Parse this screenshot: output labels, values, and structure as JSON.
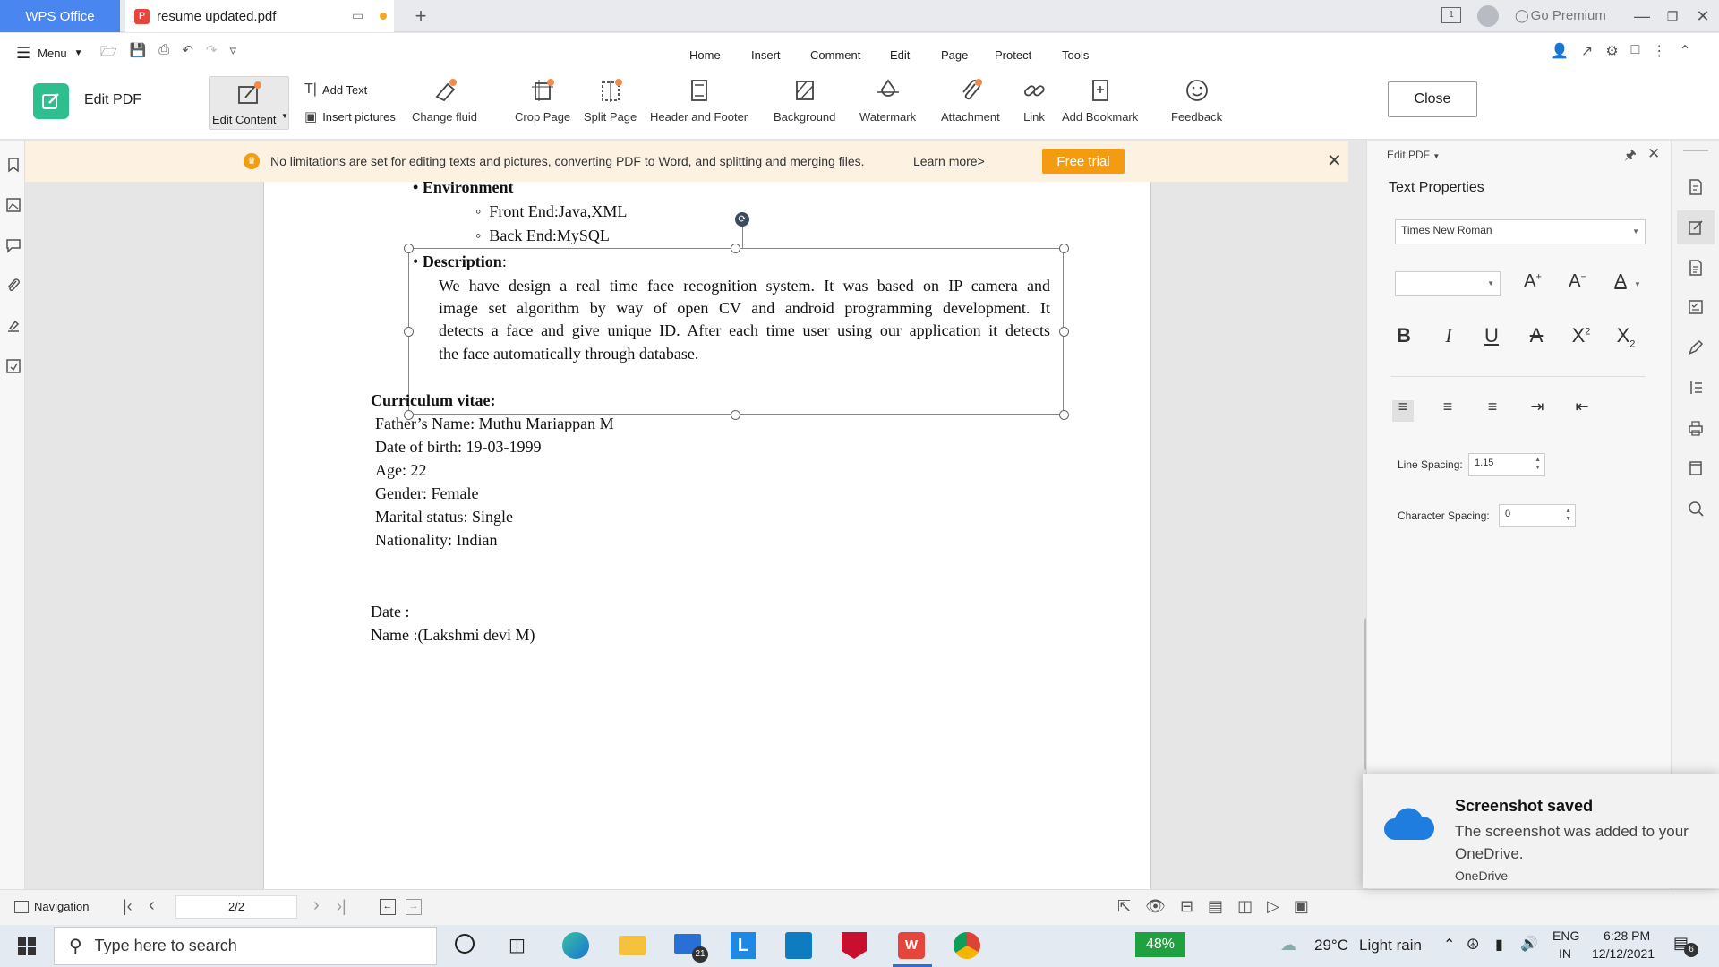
{
  "titlebar": {
    "app_tab": "WPS Office",
    "doc_tab": "resume updated.pdf",
    "go_premium": "Go Premium",
    "page_indicator": "1"
  },
  "menubar": {
    "menu_label": "Menu",
    "tabs": [
      "Home",
      "Insert",
      "Comment",
      "Edit",
      "Page",
      "Protect",
      "Tools"
    ]
  },
  "ribbon": {
    "mode_title": "Edit PDF",
    "edit_content": "Edit Content",
    "add_text": "Add Text",
    "insert_pictures": "Insert pictures",
    "change_fluid": "Change fluid",
    "crop_page": "Crop Page",
    "split_page": "Split Page",
    "header_footer": "Header and Footer",
    "background": "Background",
    "watermark": "Watermark",
    "attachment": "Attachment",
    "link": "Link",
    "add_bookmark": "Add Bookmark",
    "feedback": "Feedback",
    "close": "Close"
  },
  "notice": {
    "text": "No limitations are set for editing texts and pictures, converting PDF to Word, and splitting and merging files.",
    "link": "Learn more>",
    "button": "Free trial"
  },
  "document": {
    "environment_heading": "Environment",
    "front_end": "Front End:Java,XML",
    "back_end": "Back End:MySQL",
    "description_heading": "Description",
    "description_colon": ":",
    "description_lines": [
      "We have design a real time face recognition system. It was based on IP camera and",
      "image set algorithm by way of open CV and android programming development. It",
      "detects a face and give unique ID. After each time user using our application it  detects",
      "the face automatically through database."
    ],
    "cv_heading": "Curriculum vitae:",
    "cv_lines": [
      "Father’s Name: Muthu Mariappan M",
      "Date of birth: 19-03-1999",
      "Age: 22",
      "Gender: Female",
      "Marital status: Single",
      "Nationality: Indian"
    ],
    "date_line": "Date  :",
    "name_line": "Name :(Lakshmi devi M)"
  },
  "right_panel": {
    "header": "Edit PDF",
    "section_title": "Text Properties",
    "font_family": "Times New Roman",
    "font_size": "",
    "line_spacing_label": "Line Spacing:",
    "line_spacing_value": "1.15",
    "char_spacing_label": "Character Spacing:",
    "char_spacing_value": "0"
  },
  "statusbar": {
    "navigation": "Navigation",
    "page_field": "2/2"
  },
  "toast": {
    "title": "Screenshot saved",
    "body": "The screenshot was added to your OneDrive.",
    "source": "OneDrive"
  },
  "taskbar": {
    "search_placeholder": "Type here to search",
    "mail_badge": "21",
    "battery": "48%",
    "weather_temp": "29°C",
    "weather_desc": "Light rain",
    "lang_top": "ENG",
    "lang_bottom": "IN",
    "time": "6:28 PM",
    "date": "12/12/2021",
    "notif_count": "6"
  },
  "colors": {
    "wps_blue": "#4a86f0",
    "accent_green": "#2fbf8f",
    "free_trial": "#f39c12",
    "notice_bg": "#fdf1e2",
    "onedrive_blue": "#1f7de0"
  }
}
